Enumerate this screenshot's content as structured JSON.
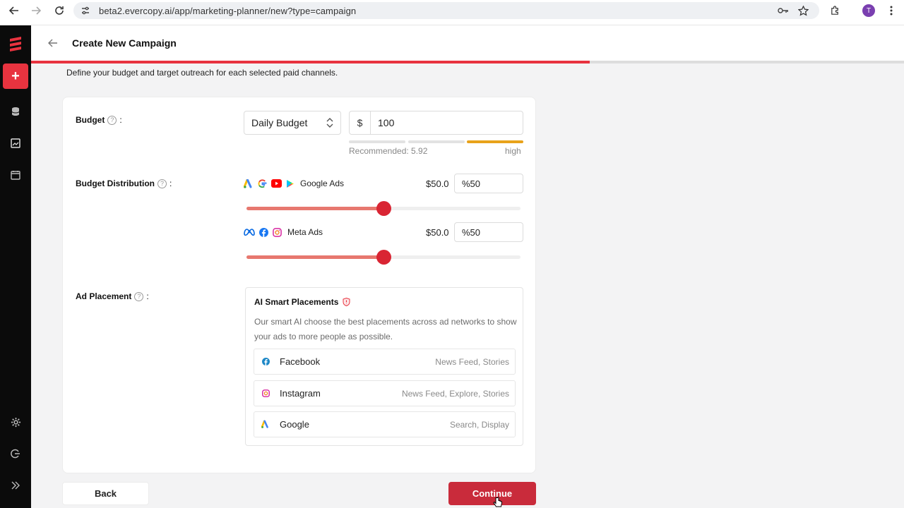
{
  "browser": {
    "url": "beta2.evercopy.ai/app/marketing-planner/new?type=campaign",
    "avatar_letter": "T"
  },
  "header": {
    "title": "Create New Campaign",
    "progress_fraction": 0.64
  },
  "subtitle": "Define your budget and target outreach for each selected paid channels.",
  "budget": {
    "label": "Budget",
    "type_value": "Daily Budget",
    "currency": "$",
    "amount": "100",
    "recommended": "Recommended: 5.92",
    "level": "high"
  },
  "distribution": {
    "label": "Budget Distribution",
    "channels": [
      {
        "name": "Google Ads",
        "amount": "$50.0",
        "percent": "%50",
        "fraction": 0.5
      },
      {
        "name": "Meta Ads",
        "amount": "$50.0",
        "percent": "%50",
        "fraction": 0.5
      }
    ]
  },
  "placement": {
    "label": "Ad Placement",
    "title": "AI Smart Placements",
    "description": "Our smart AI choose the best placements across ad networks to show your ads to more people as possible.",
    "items": [
      {
        "name": "Facebook",
        "detail": "News Feed, Stories"
      },
      {
        "name": "Instagram",
        "detail": "News Feed, Explore, Stories"
      },
      {
        "name": "Google",
        "detail": "Search, Display"
      }
    ]
  },
  "buttons": {
    "back": "Back",
    "continue": "Continue"
  },
  "colors": {
    "accent": "#e8333f",
    "continue": "#c92b3b",
    "meter_active": "#e8a21a"
  }
}
